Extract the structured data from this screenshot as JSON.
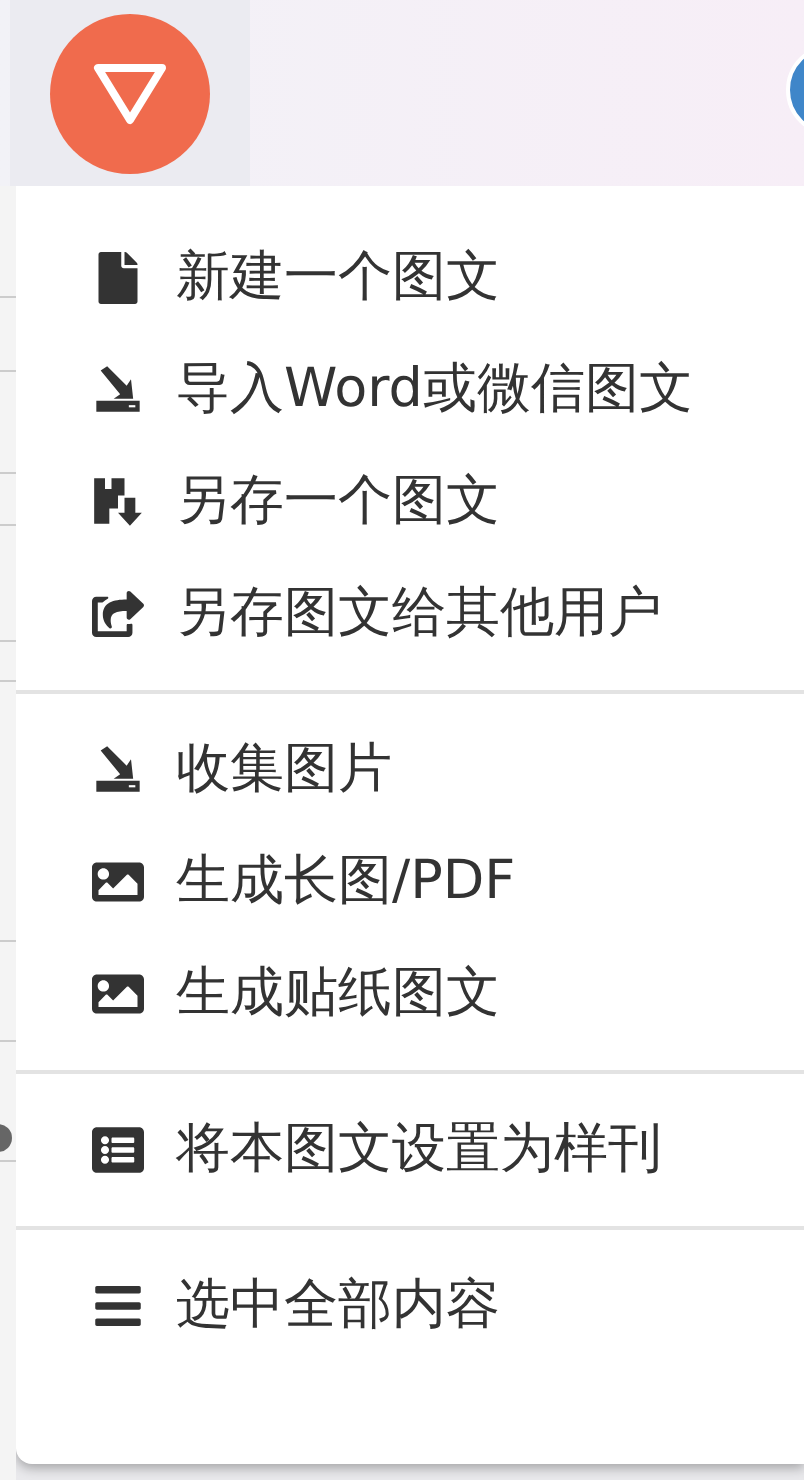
{
  "menu": {
    "groups": [
      [
        {
          "kind": "file",
          "label": "新建一个图文"
        },
        {
          "kind": "import",
          "label": "导入Word或微信图文"
        },
        {
          "kind": "save",
          "label": "另存一个图文"
        },
        {
          "kind": "share",
          "label": "另存图文给其他用户"
        }
      ],
      [
        {
          "kind": "import",
          "label": "收集图片"
        },
        {
          "kind": "image",
          "label": "生成长图/PDF"
        },
        {
          "kind": "image",
          "label": "生成贴纸图文"
        }
      ],
      [
        {
          "kind": "list",
          "label": "将本图文设置为样刊"
        }
      ],
      [
        {
          "kind": "bars",
          "label": "选中全部内容"
        }
      ]
    ]
  }
}
